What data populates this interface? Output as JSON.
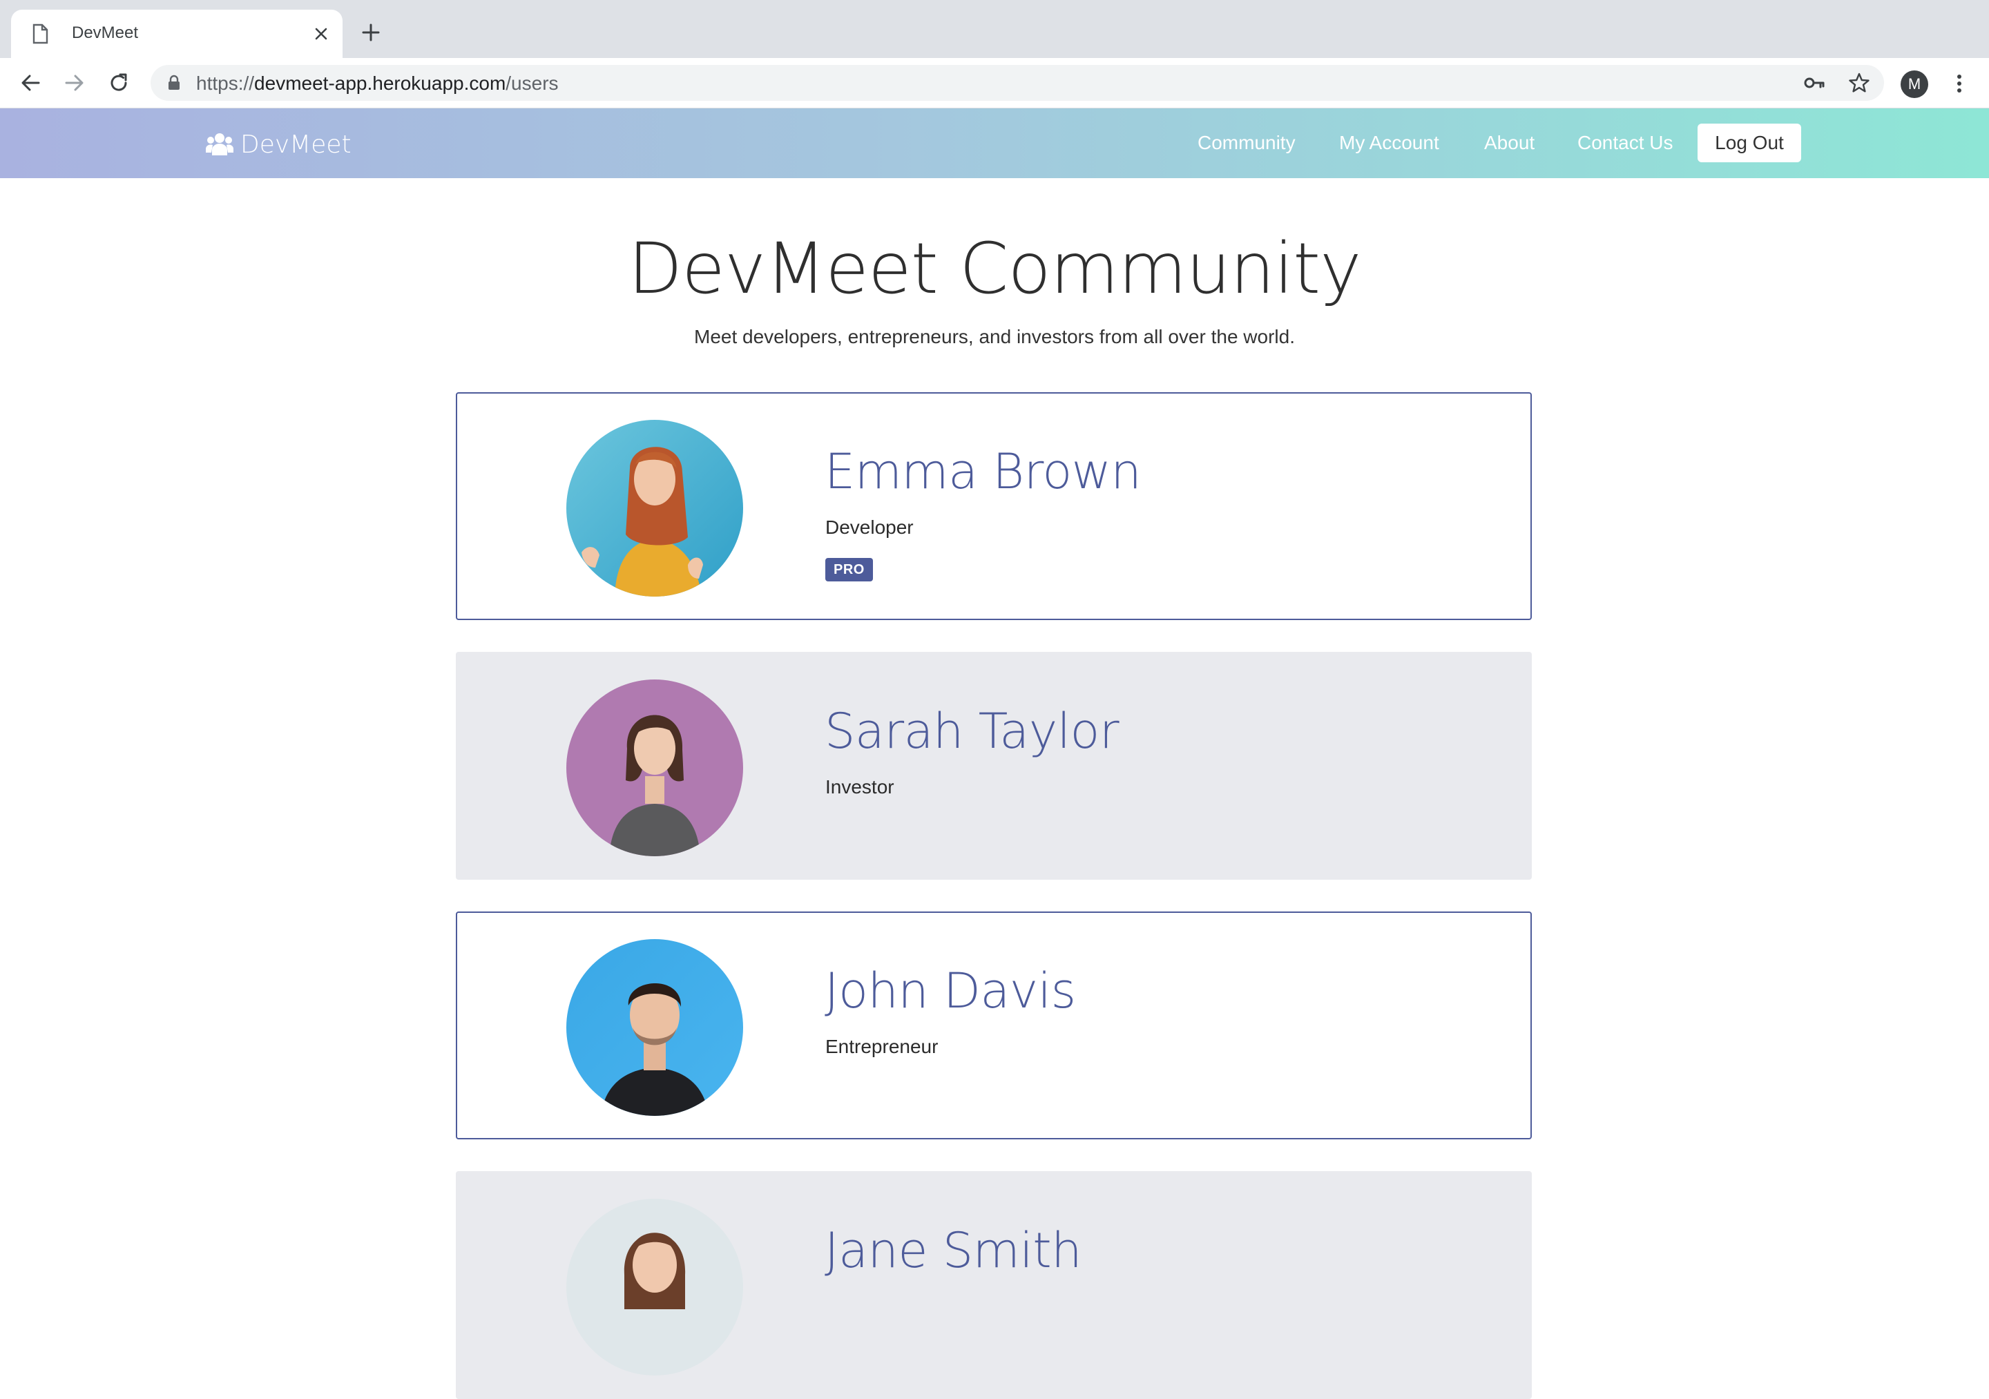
{
  "browser": {
    "tab_title": "DevMeet",
    "url_scheme": "https://",
    "url_host": "devmeet-app.herokuapp.com",
    "url_path": "/users",
    "profile_initial": "M"
  },
  "navbar": {
    "brand": "DevMeet",
    "links": [
      "Community",
      "My Account",
      "About",
      "Contact Us"
    ],
    "logout_label": "Log Out"
  },
  "main": {
    "title": "DevMeet Community",
    "subtitle": "Meet developers, entrepreneurs, and investors from all over the world.",
    "users": [
      {
        "name": "Emma Brown",
        "role": "Developer",
        "badge": "PRO"
      },
      {
        "name": "Sarah Taylor",
        "role": "Investor"
      },
      {
        "name": "John Davis",
        "role": "Entrepreneur"
      },
      {
        "name": "Jane Smith",
        "role": ""
      }
    ]
  },
  "colors": {
    "accent": "#4d5b9a",
    "navbar_gradient_start": "#a9b2e0",
    "navbar_gradient_end": "#8ee6d6",
    "card_shaded": "#e9eaee"
  }
}
